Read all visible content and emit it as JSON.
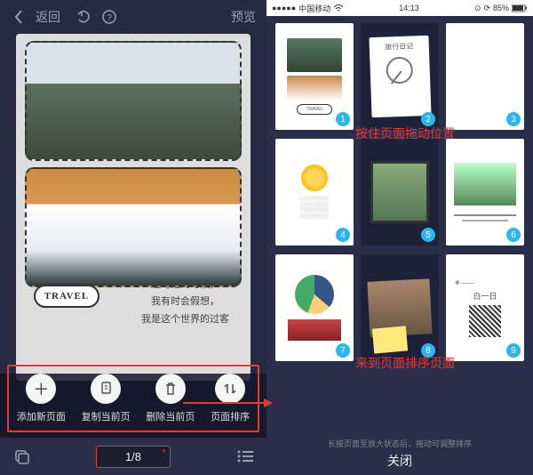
{
  "left_header": {
    "back_label": "返回",
    "preview_label": "预览"
  },
  "canvas": {
    "travel_tag": "TRAVEL",
    "caption_line1": "过马路的时候，",
    "caption_line2": "我有时会假想，",
    "caption_line3": "我是这个世界的过客"
  },
  "action_bar": {
    "add_label": "添加新页面",
    "copy_label": "复制当前页",
    "delete_label": "删除当前页",
    "sort_label": "页面排序"
  },
  "bottom_bar": {
    "page_indicator": "1/8"
  },
  "status_bar": {
    "carrier": "中国移动",
    "time": "14:13",
    "battery": "85%"
  },
  "thumbnails": [
    {
      "index": "1",
      "title": ""
    },
    {
      "index": "2",
      "title": "旅行日记"
    },
    {
      "index": "3",
      "title": ""
    },
    {
      "index": "4",
      "title": ""
    },
    {
      "index": "5",
      "title": ""
    },
    {
      "index": "6",
      "title": ""
    },
    {
      "index": "7",
      "title": ""
    },
    {
      "index": "8",
      "title": ""
    },
    {
      "index": "9",
      "title": "白一日"
    }
  ],
  "annotations": {
    "drag_hint": "按住页面拖动位置",
    "sort_page_hint": "来到页面排序页面"
  },
  "right_footer": {
    "hint": "长按页面至放大状态后，拖动可调整排序",
    "close": "关闭"
  }
}
